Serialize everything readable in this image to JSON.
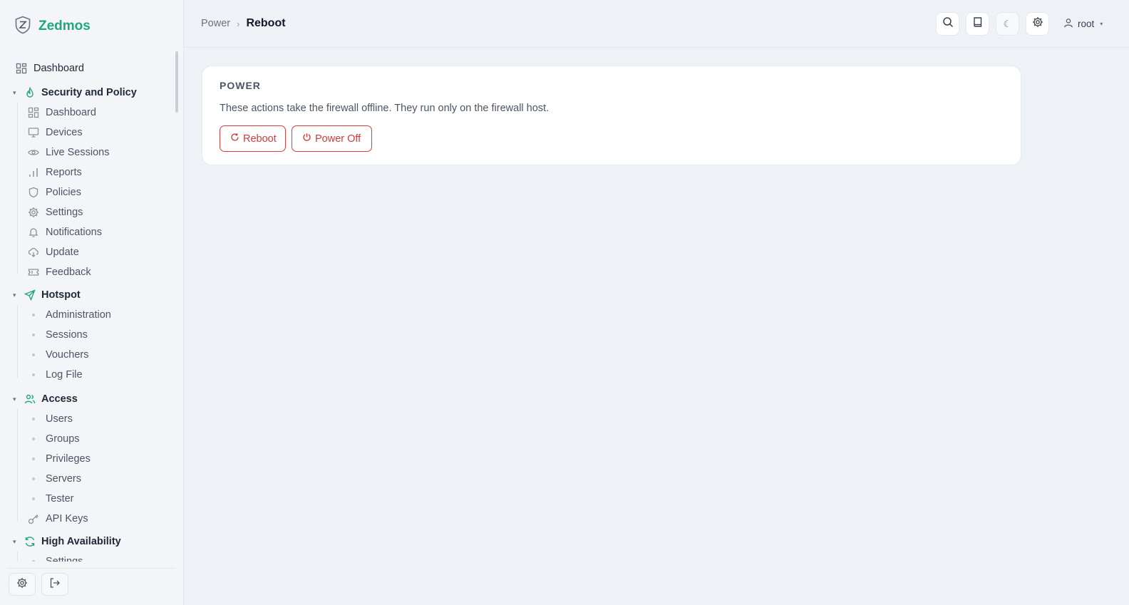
{
  "app": {
    "name": "Zedmos",
    "logo_letter": "Z"
  },
  "sidebar": {
    "dashboard": {
      "label": "Dashboard",
      "icon": "layout-grid-icon"
    },
    "sections": [
      {
        "label": "Security and Policy",
        "icon": "flame-icon",
        "items": [
          {
            "label": "Dashboard",
            "icon": "layout-grid-icon"
          },
          {
            "label": "Devices",
            "icon": "monitor-icon"
          },
          {
            "label": "Live Sessions",
            "icon": "eye-icon"
          },
          {
            "label": "Reports",
            "icon": "bar-chart-icon"
          },
          {
            "label": "Policies",
            "icon": "shield-icon"
          },
          {
            "label": "Settings",
            "icon": "gear-icon"
          },
          {
            "label": "Notifications",
            "icon": "bell-icon"
          },
          {
            "label": "Update",
            "icon": "cloud-download-icon"
          },
          {
            "label": "Feedback",
            "icon": "ticket-icon"
          }
        ]
      },
      {
        "label": "Hotspot",
        "icon": "send-icon",
        "items": [
          {
            "label": "Administration"
          },
          {
            "label": "Sessions"
          },
          {
            "label": "Vouchers"
          },
          {
            "label": "Log File"
          }
        ]
      },
      {
        "label": "Access",
        "icon": "users-icon",
        "items": [
          {
            "label": "Users"
          },
          {
            "label": "Groups"
          },
          {
            "label": "Privileges"
          },
          {
            "label": "Servers"
          },
          {
            "label": "Tester"
          },
          {
            "label": "API Keys",
            "icon": "key-icon"
          }
        ]
      },
      {
        "label": "High Availability",
        "icon": "refresh-icon",
        "items": [
          {
            "label": "Settings"
          }
        ]
      }
    ]
  },
  "header": {
    "breadcrumb": {
      "parent": "Power",
      "separator": "›",
      "current": "Reboot"
    },
    "user": {
      "name": "root"
    },
    "moon_glyph": "☾",
    "caret_glyph": "▾"
  },
  "card": {
    "title": "POWER",
    "description": "These actions take the firewall offline. They run only on the firewall host.",
    "reboot_label": "Reboot",
    "poweroff_label": "Power Off"
  },
  "colors": {
    "accent": "#1fa87a",
    "danger": "#dc3b3b",
    "background": "#eef1f5"
  }
}
